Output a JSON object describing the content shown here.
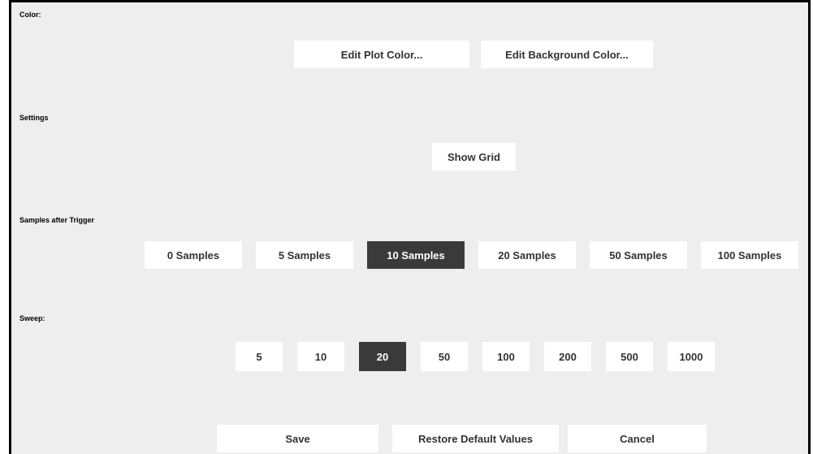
{
  "sections": {
    "color": {
      "label": "Color:",
      "edit_plot_color": "Edit Plot Color...",
      "edit_background_color": "Edit Background Color..."
    },
    "settings": {
      "label": "Settings",
      "show_grid": "Show Grid"
    },
    "samples_after_trigger": {
      "label": "Samples after Trigger",
      "options": [
        "0 Samples",
        "5 Samples",
        "10 Samples",
        "20 Samples",
        "50 Samples",
        "100 Samples"
      ],
      "selected": "10 Samples"
    },
    "sweep": {
      "label": "Sweep:",
      "options": [
        "5",
        "10",
        "20",
        "50",
        "100",
        "200",
        "500",
        "1000"
      ],
      "selected": "20"
    }
  },
  "footer": {
    "save": "Save",
    "restore_defaults": "Restore Default Values",
    "cancel": "Cancel"
  },
  "colors": {
    "panel_background": "#eeeeee",
    "button_background": "#ffffff",
    "selected_background": "#3a3a3a",
    "selected_text": "#ffffff"
  }
}
